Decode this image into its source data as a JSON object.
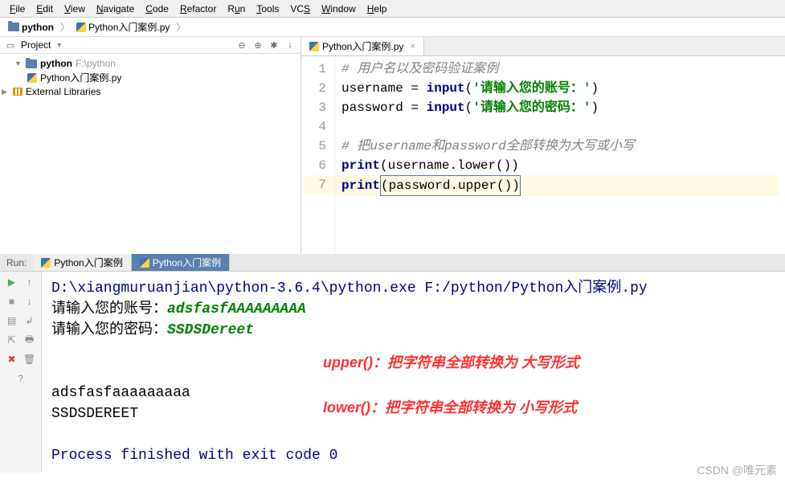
{
  "menu": {
    "file": "File",
    "edit": "Edit",
    "view": "View",
    "navigate": "Navigate",
    "code": "Code",
    "refactor": "Refactor",
    "run": "Run",
    "tools": "Tools",
    "vcs": "VCS",
    "window": "Window",
    "help": "Help"
  },
  "breadcrumb": {
    "root": "python",
    "file": "Python入门案例.py"
  },
  "project": {
    "title": "Project",
    "root": "python",
    "root_path": "F:\\python",
    "file": "Python入门案例.py",
    "external": "External Libraries"
  },
  "editor": {
    "tab": "Python入门案例.py",
    "lines": {
      "l1_comment": "#  用户名以及密码验证案例",
      "l2_var": "username",
      "l2_eq": " = ",
      "l2_fn": "input",
      "l2_str": "'请输入您的账号：'",
      "l3_var": "password",
      "l3_eq": " = ",
      "l3_fn": "input",
      "l3_str": "'请输入您的密码：'",
      "l5_comment": "#  把username和password全部转换为大写或小写",
      "l6_fn": "print",
      "l6_arg": "username.lower()",
      "l7_fn": "print",
      "l7_arg": "password.upper()"
    }
  },
  "run": {
    "label": "Run:",
    "tab1": "Python入门案例",
    "tab2": "Python入门案例",
    "cmd": "D:\\xiangmuruanjian\\python-3.6.4\\python.exe F:/python/Python入门案例.py",
    "prompt1": "请输入您的账号：",
    "input1": "adsfasfAAAAAAAAA",
    "prompt2": "请输入您的密码：",
    "input2": "SSDSDereet",
    "out1": "adsfasfaaaaaaaaa",
    "out2": "SSDSDEREET",
    "exit": "Process finished with exit code 0"
  },
  "notes": {
    "upper": "upper()：把字符串全部转换为  大写形式",
    "lower": "lower()：把字符串全部转换为   小写形式"
  },
  "watermark": "CSDN @唯元素",
  "gutter": {
    "n1": "1",
    "n2": "2",
    "n3": "3",
    "n4": "4",
    "n5": "5",
    "n6": "6",
    "n7": "7"
  }
}
